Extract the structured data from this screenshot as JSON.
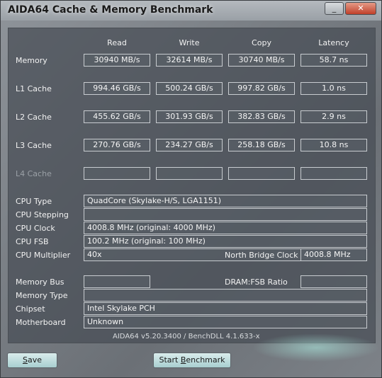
{
  "window": {
    "title": "AIDA64 Cache & Memory Benchmark",
    "btn_minimize": "_",
    "btn_close": "✕"
  },
  "headers": {
    "read": "Read",
    "write": "Write",
    "copy": "Copy",
    "latency": "Latency"
  },
  "rows": {
    "memory": {
      "label": "Memory",
      "read": "30940 MB/s",
      "write": "32614 MB/s",
      "copy": "30740 MB/s",
      "latency": "58.7 ns"
    },
    "l1": {
      "label": "L1 Cache",
      "read": "994.46 GB/s",
      "write": "500.24 GB/s",
      "copy": "997.82 GB/s",
      "latency": "1.0 ns"
    },
    "l2": {
      "label": "L2 Cache",
      "read": "455.62 GB/s",
      "write": "301.93 GB/s",
      "copy": "382.83 GB/s",
      "latency": "2.9 ns"
    },
    "l3": {
      "label": "L3 Cache",
      "read": "270.76 GB/s",
      "write": "234.27 GB/s",
      "copy": "258.18 GB/s",
      "latency": "10.8 ns"
    },
    "l4": {
      "label": "L4 Cache",
      "read": "",
      "write": "",
      "copy": "",
      "latency": ""
    }
  },
  "cpu": {
    "type_label": "CPU Type",
    "type": "QuadCore   (Skylake-H/S, LGA1151)",
    "stepping_label": "CPU Stepping",
    "stepping": "",
    "clock_label": "CPU Clock",
    "clock": "4008.8 MHz  (original: 4000 MHz)",
    "fsb_label": "CPU FSB",
    "fsb": "100.2 MHz  (original: 100 MHz)",
    "multiplier_label": "CPU Multiplier",
    "multiplier": "40x",
    "nb_clock_label": "North Bridge Clock",
    "nb_clock": "4008.8 MHz"
  },
  "memory_info": {
    "bus_label": "Memory Bus",
    "bus": "",
    "dram_ratio_label": "DRAM:FSB Ratio",
    "dram_ratio": "",
    "type_label": "Memory Type",
    "type": "",
    "chipset_label": "Chipset",
    "chipset": "Intel Skylake PCH",
    "motherboard_label": "Motherboard",
    "motherboard": "Unknown"
  },
  "footer": "AIDA64 v5.20.3400 / BenchDLL 4.1.633-x",
  "buttons": {
    "save_accel": "S",
    "save_rest": "ave",
    "start_pre": "Start ",
    "start_accel": "B",
    "start_rest": "enchmark"
  }
}
